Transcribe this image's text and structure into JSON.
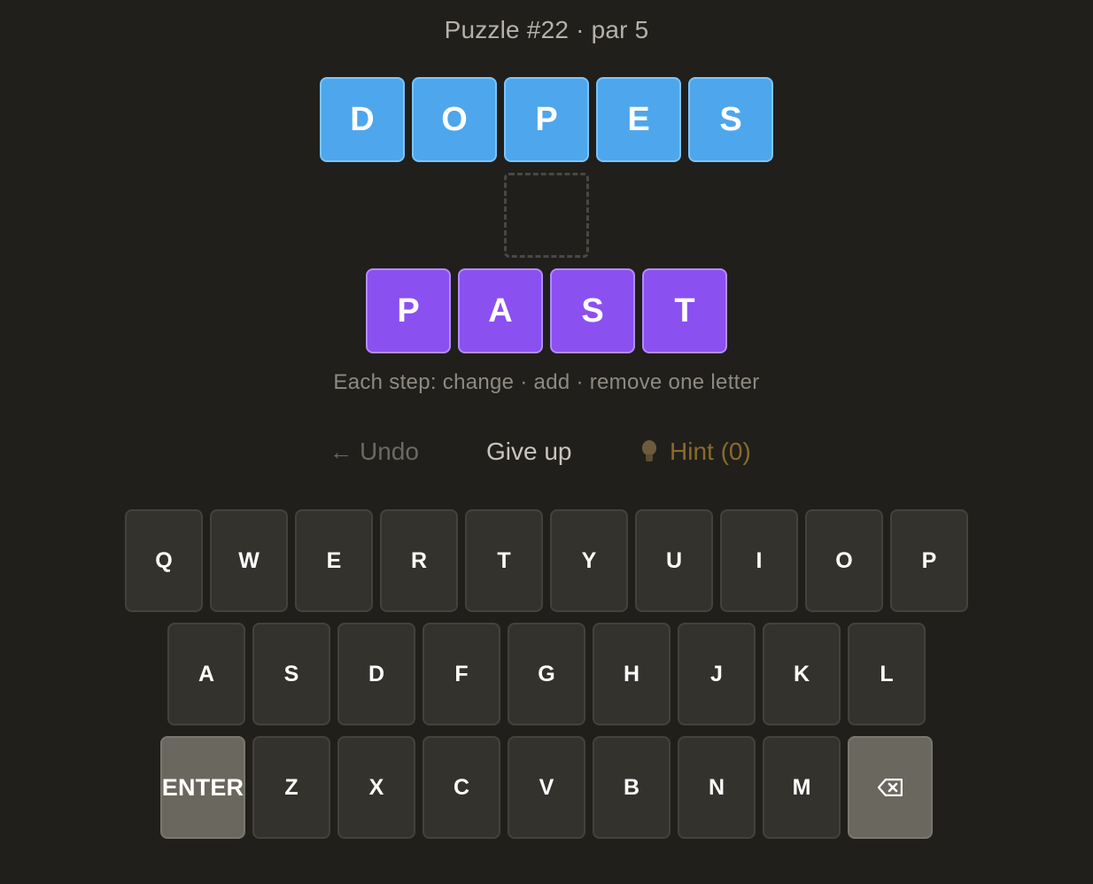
{
  "header": {
    "title": "Puzzle #22 · par 5"
  },
  "start_word": [
    "D",
    "O",
    "P",
    "E",
    "S"
  ],
  "target_word": [
    "P",
    "A",
    "S",
    "T"
  ],
  "rules": "Each step: change · add · remove one letter",
  "actions": {
    "undo_label": "Undo",
    "give_up_label": "Give up",
    "hint_label": "Hint (0)"
  },
  "keyboard": {
    "row1": [
      "Q",
      "W",
      "E",
      "R",
      "T",
      "Y",
      "U",
      "I",
      "O",
      "P"
    ],
    "row2": [
      "A",
      "S",
      "D",
      "F",
      "G",
      "H",
      "J",
      "K",
      "L"
    ],
    "row3": [
      "Z",
      "X",
      "C",
      "V",
      "B",
      "N",
      "M"
    ],
    "enter_label": "ENTER",
    "backspace_icon": "backspace-icon"
  },
  "colors": {
    "background": "#201f1b",
    "start_tile": "#4ea6ec",
    "target_tile": "#8b50f0",
    "hint_text": "#8a6a2c",
    "key": "#34322d",
    "special_key": "#6a675e"
  }
}
